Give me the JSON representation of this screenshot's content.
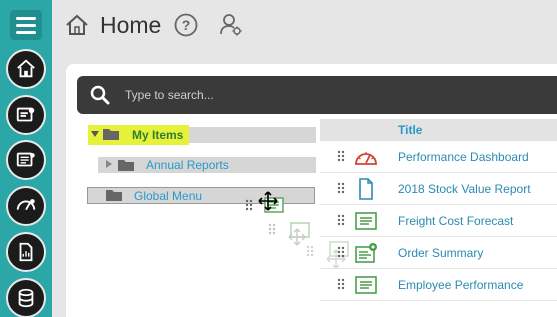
{
  "header": {
    "title": "Home"
  },
  "search": {
    "placeholder": "Type to search..."
  },
  "tree": [
    {
      "label": "My Items"
    },
    {
      "label": "Annual Reports"
    },
    {
      "label": "Global Menu"
    }
  ],
  "table": {
    "column_title": "Title",
    "rows": [
      {
        "title": "Performance Dashboard",
        "icon": "dashboard-icon"
      },
      {
        "title": "2018 Stock Value Report",
        "icon": "document-icon"
      },
      {
        "title": "Freight Cost Forecast",
        "icon": "report-icon"
      },
      {
        "title": "Order Summary",
        "icon": "report-settings-icon"
      },
      {
        "title": "Employee Performance",
        "icon": "report-icon"
      }
    ]
  },
  "colors": {
    "rail": "#2ba7a8",
    "accent_link": "#2a8bb3",
    "highlight": "#e6f23a",
    "search_bar": "#3a3a3a"
  }
}
